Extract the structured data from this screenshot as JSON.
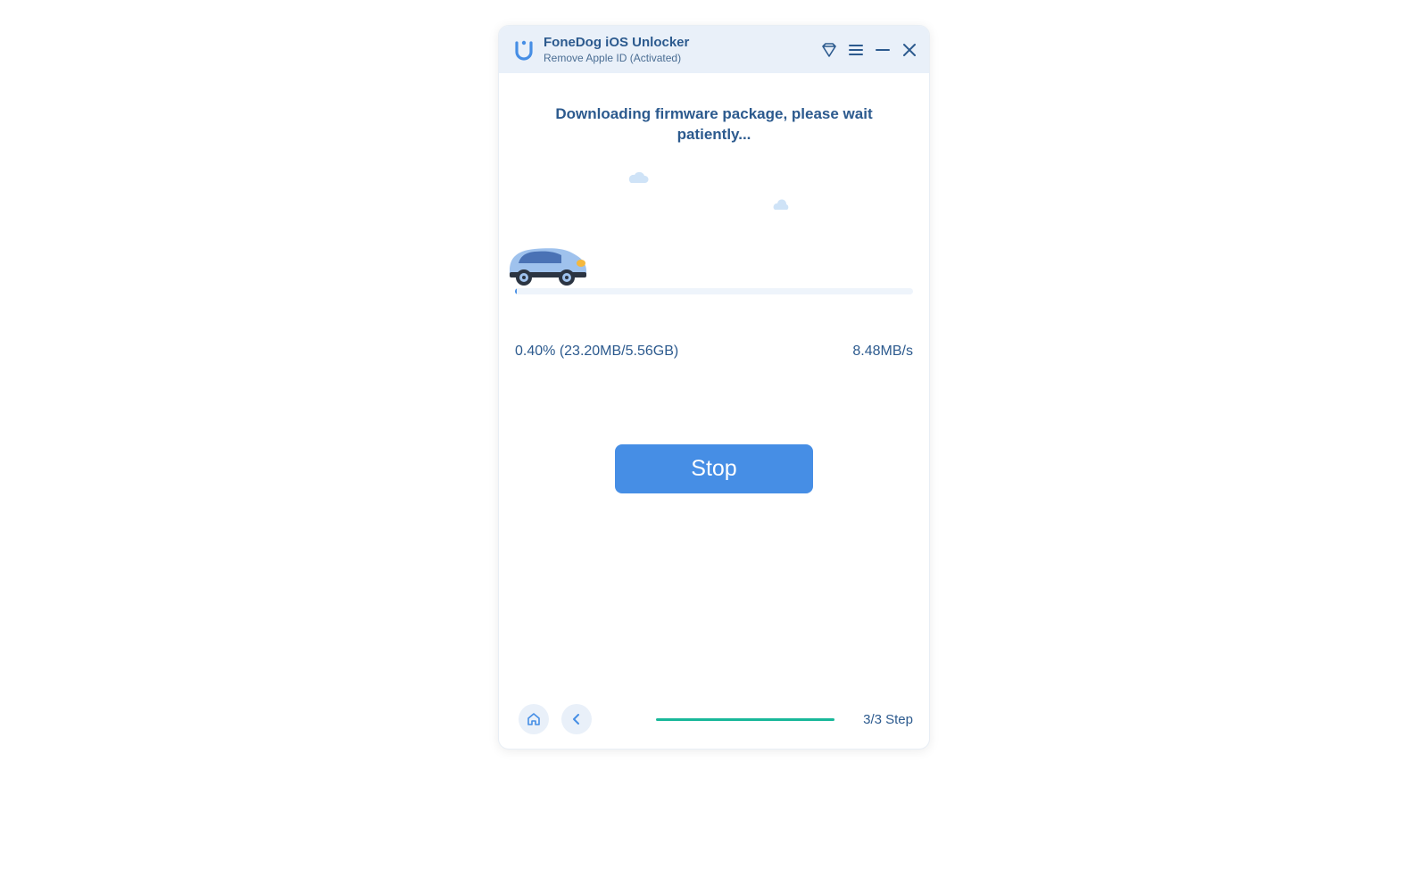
{
  "header": {
    "title": "FoneDog iOS Unlocker",
    "subtitle": "Remove Apple ID  (Activated)"
  },
  "main": {
    "status_message": "Downloading firmware package, please wait patiently...",
    "progress_percent": 0.4,
    "progress_label": "0.40% (23.20MB/5.56GB)",
    "speed_label": "8.48MB/s",
    "stop_button_label": "Stop"
  },
  "footer": {
    "step_label": "3/3 Step"
  },
  "colors": {
    "primary_text": "#2c5a8e",
    "button_bg": "#468ee5",
    "accent_teal": "#19b89a",
    "panel_bg": "#e9f0f9"
  }
}
